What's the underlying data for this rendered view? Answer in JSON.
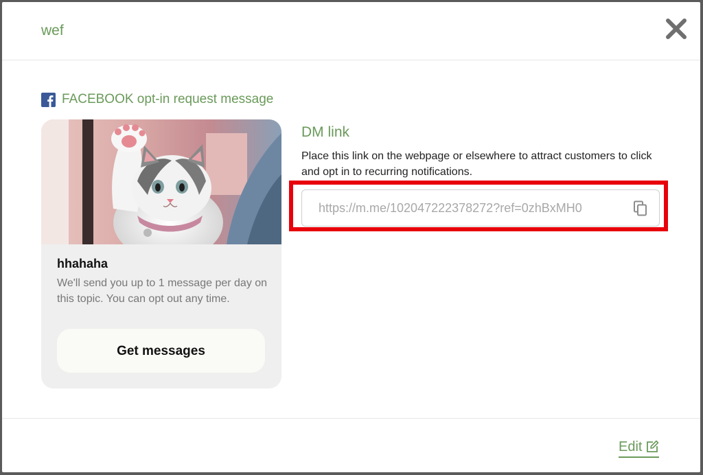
{
  "modal": {
    "title": "wef",
    "close_icon": "close-icon"
  },
  "section": {
    "title": "FACEBOOK opt-in request message",
    "icon": "facebook-icon"
  },
  "card": {
    "image": "kitten-photo",
    "title": "hhahaha",
    "description": "We'll send you up to 1 message per day on this topic. You can opt out any time.",
    "button_label": "Get messages"
  },
  "dm_link": {
    "title": "DM link",
    "description": "Place this link on the webpage or elsewhere to attract customers to click and opt in to recurring notifications.",
    "url": "https://m.me/102047222378272?ref=0zhBxMH0",
    "copy_icon": "copy-icon"
  },
  "footer": {
    "edit_label": "Edit",
    "edit_icon": "edit-icon"
  },
  "colors": {
    "accent_green": "#6a9a5a",
    "highlight_red": "#e8000b",
    "facebook_blue": "#3b5998"
  }
}
